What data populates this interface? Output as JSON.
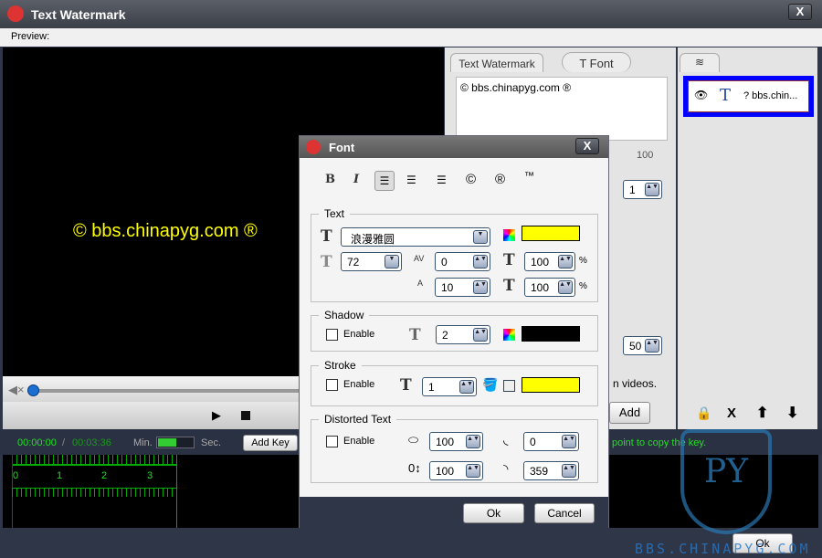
{
  "window": {
    "title": "Text Watermark",
    "close": "X",
    "preview_label": "Preview:"
  },
  "preview": {
    "watermark_text": "© bbs.chinapyg.com ®",
    "watermark_color": "#ffff00"
  },
  "player": {
    "progress": 0,
    "current_time": "00:00:00",
    "separator": "/",
    "total_time": "00:03:36",
    "min_label": "Min.",
    "sec_label": "Sec.",
    "add_key": "Add Key",
    "hint": "point to copy the key.",
    "ruler_ticks": [
      "0",
      "1",
      "2",
      "3"
    ]
  },
  "tabs": {
    "text_watermark": "Text Watermark",
    "font": "T Font"
  },
  "text_editor": {
    "value": "© bbs.chinapyg.com ®",
    "opacity": "100",
    "repeat": "1",
    "angle": "50",
    "videos_text": "n videos.",
    "add": "Add"
  },
  "layers": {
    "items": [
      {
        "label": "? bbs.chin...",
        "visible": true
      }
    ],
    "buttons": [
      "lock",
      "delete",
      "up",
      "down"
    ],
    "delete_label": "X"
  },
  "font_dialog": {
    "title": "Font",
    "close": "X",
    "toolbar": {
      "bold": "B",
      "italic": "I",
      "copyright": "©",
      "registered": "®",
      "trademark": "™"
    },
    "text": {
      "label": "Text",
      "font": "浪漫雅圆",
      "color": "#ffff00",
      "size": "72",
      "spacing": "0",
      "width_pct": "100",
      "line_spacing": "10",
      "height_pct": "100",
      "pct": "%"
    },
    "shadow": {
      "label": "Shadow",
      "enable": "Enable",
      "enabled": false,
      "depth": "2",
      "color": "#000000"
    },
    "stroke": {
      "label": "Stroke",
      "enable": "Enable",
      "enabled": false,
      "width": "1",
      "color": "#ffff00"
    },
    "distorted": {
      "label": "Distorted Text",
      "enable": "Enable",
      "enabled": false,
      "h": "100",
      "v": "100",
      "start": "0",
      "end": "359"
    },
    "ok": "Ok",
    "cancel": "Cancel"
  },
  "footer": {
    "ok": "Ok",
    "watermark_logo": "BBS.CHINAPYG.COM"
  }
}
